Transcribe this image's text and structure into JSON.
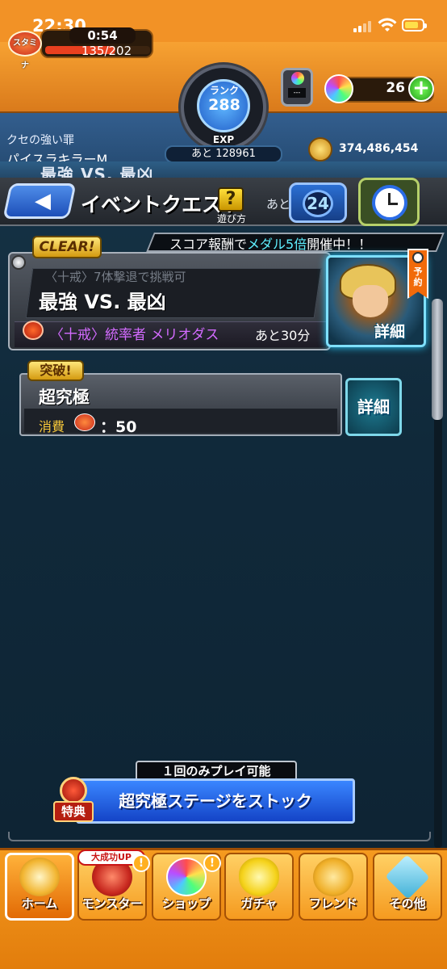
{
  "status_bar": {
    "time": "22:30"
  },
  "header": {
    "stamina_icon_label": "スタミナ",
    "stamina_timer": "0:54",
    "stamina_value": "135/202",
    "stamina_fill": 0.668,
    "rank_label": "ランク",
    "rank_value": "288",
    "exp_label": "EXP",
    "exp_remaining": "あと 128961",
    "box_screen": "---",
    "orb_count": "26",
    "plus_label": "+",
    "coin_value": "374,486,454",
    "current_quest_label": "クセの強い罪",
    "current_quest_name": "パイスラキラーM"
  },
  "behind_text": "最強 VS. 最凶",
  "nav_header": {
    "back_icon": "back-arrow-icon",
    "title": "イベントクエスト",
    "howto_symbol": "?",
    "howto_label": "遊び方",
    "ato_label": "あと",
    "days_badge": "24"
  },
  "banner": {
    "prefix": "スコア報酬で",
    "highlight": "メダル5倍",
    "suffix": "開催中！！"
  },
  "quest": {
    "clear_badge": "CLEAR!",
    "condition": "〈十戒〉7体撃退で挑戦可",
    "name": "最強 VS. 最凶",
    "boss": "〈十戒〉統率者 メリオダス",
    "remaining": "あと30分",
    "detail_label": "詳細",
    "reserve_label": "予約"
  },
  "sub_quest": {
    "badge": "突破!",
    "title": "超究極",
    "cost_label": "消費",
    "cost_value": "：50",
    "detail_label": "詳細"
  },
  "stock": {
    "once_label": "１回のみプレイ可能",
    "button_label": "超究極ステージをストック",
    "bonus_label": "特典"
  },
  "nav_bar": {
    "items": [
      {
        "label": "ホーム",
        "icon": "home-icon"
      },
      {
        "label": "モンスター",
        "icon": "monster-icon",
        "badge": "大成功UP"
      },
      {
        "label": "ショップ",
        "icon": "shop-orb-icon"
      },
      {
        "label": "ガチャ",
        "icon": "gacha-egg-icon"
      },
      {
        "label": "フレンド",
        "icon": "friend-icon"
      },
      {
        "label": "その他",
        "icon": "other-icon"
      }
    ],
    "excl": "!"
  },
  "colors": {
    "accent_orange": "#f29226",
    "brand_blue": "#1d4fb8",
    "highlight_cyan": "#5ff0ff",
    "boss_purple": "#d36bff"
  }
}
